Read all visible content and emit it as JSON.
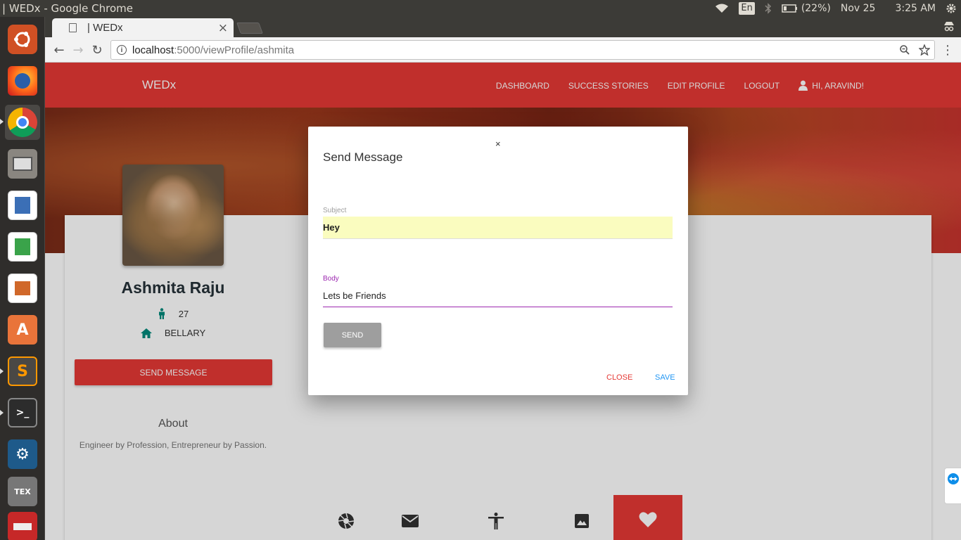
{
  "os": {
    "window_title": "| WEDx - Google Chrome",
    "keyboard_layout": "En",
    "battery": "(22%)",
    "date": "Nov 25",
    "time": "3:25 AM"
  },
  "launcher": {
    "apps": [
      "ubuntu-dash-icon",
      "firefox-icon",
      "chrome-icon",
      "files-icon",
      "writer-icon",
      "calc-icon",
      "impress-icon",
      "software-center-icon",
      "sublime-text-icon",
      "terminal-icon",
      "mysql-workbench-icon",
      "texmaker-icon",
      "drive-icon"
    ]
  },
  "browser": {
    "tab_title": "| WEDx",
    "url_host": "localhost",
    "url_path": ":5000/viewProfile/ashmita"
  },
  "navbar": {
    "brand": "WEDx",
    "links": [
      "DASHBOARD",
      "SUCCESS STORIES",
      "EDIT PROFILE",
      "LOGOUT"
    ],
    "user_greeting": "HI, ARAVIND!"
  },
  "profile": {
    "name": "Ashmita Raju",
    "age": "27",
    "city": "BELLARY",
    "send_message_label": "SEND MESSAGE",
    "about_heading": "About",
    "about_text": "Engineer by Profession, Entrepreneur by Passion."
  },
  "tabs_icons": [
    "aperture-icon",
    "mail-icon",
    "accessibility-icon",
    "image-icon",
    "heart-icon"
  ],
  "modal": {
    "close_x": "×",
    "title": "Send Message",
    "subject_label": "Subject",
    "subject_value": "Hey",
    "body_label": "Body",
    "body_value": "Lets be Friends",
    "send_label": "SEND",
    "close_label": "CLOSE",
    "save_label": "SAVE"
  },
  "colors": {
    "brand_red": "#e53935",
    "teal": "#00897b",
    "purple": "#9c27b0",
    "save_blue": "#2196f3"
  }
}
